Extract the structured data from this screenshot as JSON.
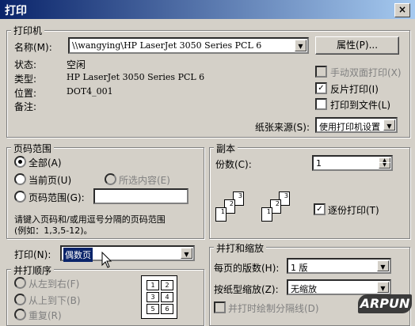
{
  "window": {
    "title": "打印",
    "close": "×"
  },
  "printer": {
    "group_title": "打印机",
    "name_label": "名称(M):",
    "name_value": "\\\\wangying\\HP LaserJet 3050 Series PCL 6",
    "properties_button": "属性(P)...",
    "status_label": "状态:",
    "status_value": "空闲",
    "type_label": "类型:",
    "type_value": "HP LaserJet 3050 Series PCL 6",
    "where_label": "位置:",
    "where_value": "DOT4_001",
    "comment_label": "备注:",
    "manual_duplex": "手动双面打印(X)",
    "reverse_print": "反片打印(I)",
    "print_to_file": "打印到文件(L)",
    "paper_source_label": "纸张来源(S):",
    "paper_source_value": "使用打印机设置"
  },
  "page_range": {
    "group_title": "页码范围",
    "all": "全部(A)",
    "current": "当前页(U)",
    "selection": "所选内容(E)",
    "pages": "页码范围(G):",
    "hint_line1": "请键入页码和/或用逗号分隔的页码范围",
    "hint_line2": "(例如：1,3,5-12)。"
  },
  "copies": {
    "group_title": "副本",
    "count_label": "份数(C):",
    "count_value": "1",
    "collate": "逐份打印(T)",
    "page_numbers": [
      "1",
      "2",
      "3"
    ]
  },
  "print_what": {
    "label": "打印(N):",
    "value": "偶数页"
  },
  "order": {
    "group_title": "并打顺序",
    "left_to_right": "从左到右(F)",
    "top_to_bottom": "从上到下(B)",
    "repeat": "重复(R)",
    "grid": [
      "1",
      "2",
      "3",
      "4",
      "5",
      "6"
    ]
  },
  "zoom": {
    "group_title": "并打和缩放",
    "pages_per_sheet_label": "每页的版数(H):",
    "pages_per_sheet_value": "1 版",
    "scale_label": "按纸型缩放(Z):",
    "scale_value": "无缩放",
    "draw_borders": "并打时绘制分隔线(D)"
  },
  "watermark": "ARPUN"
}
